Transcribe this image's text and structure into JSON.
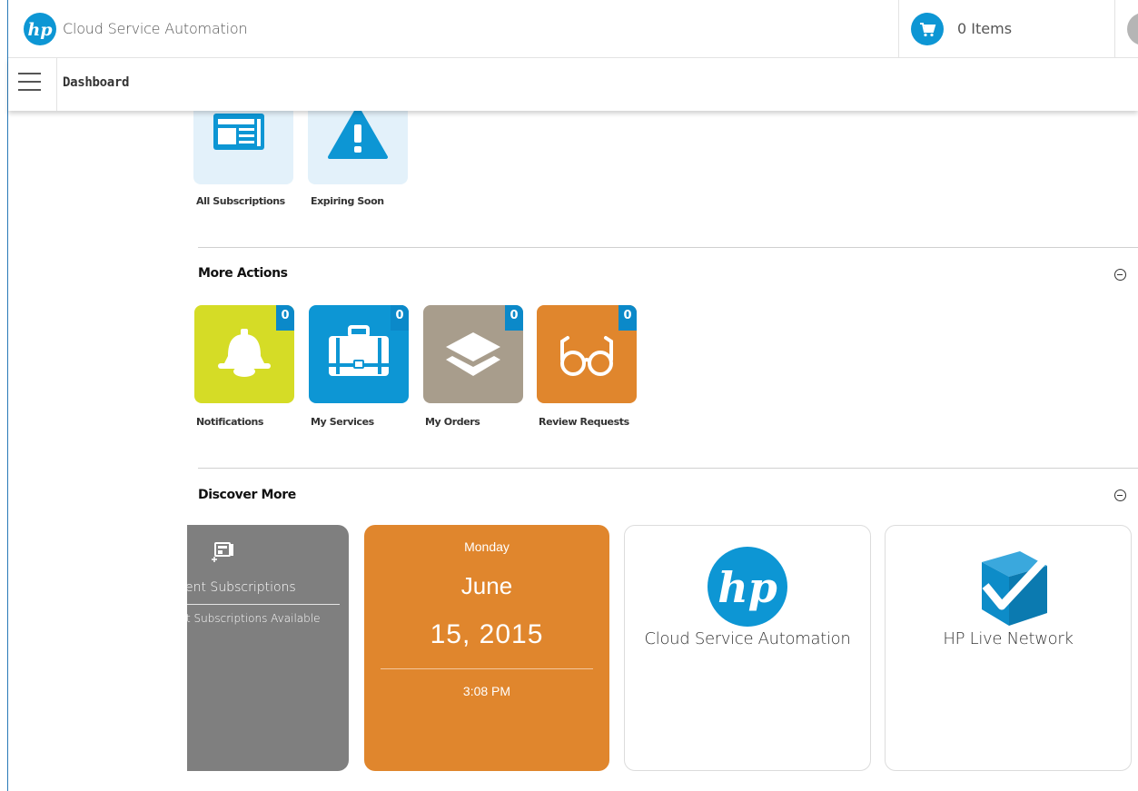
{
  "header": {
    "app_title": "Cloud Service Automation",
    "cart_label": "0 Items",
    "logo_icon": "hp-logo-icon",
    "cart_icon": "shopping-cart-icon",
    "brand_color": "#0d96d4"
  },
  "subbar": {
    "menu_icon": "hamburger-menu-icon",
    "page_title": "Dashboard"
  },
  "subscriptions": {
    "tiles": [
      {
        "label": "All Subscriptions",
        "icon": "newspaper-icon",
        "color": "#e3f1fa"
      },
      {
        "label": "Expiring Soon",
        "icon": "warning-triangle-icon",
        "color": "#e3f1fa"
      }
    ]
  },
  "more_actions": {
    "title": "More Actions",
    "tiles": [
      {
        "label": "Notifications",
        "badge": "0",
        "icon": "bell-icon",
        "color": "#d5dc26"
      },
      {
        "label": "My Services",
        "badge": "0",
        "icon": "briefcase-icon",
        "color": "#0d96d4"
      },
      {
        "label": "My Orders",
        "badge": "0",
        "icon": "layers-icon",
        "color": "#a89d8c"
      },
      {
        "label": "Review Requests",
        "badge": "0",
        "icon": "glasses-icon",
        "color": "#e0862d"
      }
    ]
  },
  "discover_more": {
    "title": "Discover More",
    "subscriptions_card": {
      "title": "ent Subscriptions",
      "subtitle": "t Subscriptions Available",
      "icon": "subscriptions-icon"
    },
    "calendar_card": {
      "day": "Monday",
      "month": "June",
      "date": "15, 2015",
      "time": "3:08 PM"
    },
    "hp_card": {
      "caption": "Cloud Service Automation",
      "icon": "hp-logo-icon"
    },
    "live_card": {
      "caption": "HP Live Network",
      "icon": "hp-live-network-icon"
    }
  }
}
